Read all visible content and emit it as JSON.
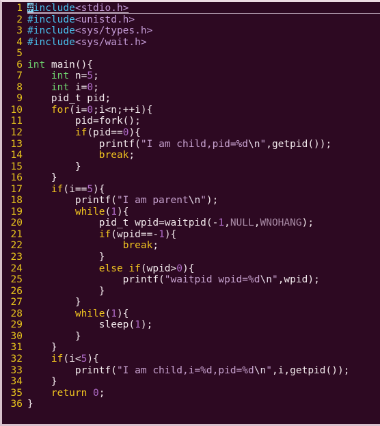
{
  "editor": {
    "language": "c",
    "total_lines": 36,
    "cursor": {
      "line": 1,
      "column": 1,
      "char": "#"
    },
    "colors": {
      "background": "#2d0922",
      "foreground": "#f2e9ec",
      "line_number": "#e8c51c",
      "preprocessor": "#49c0ed",
      "header_name": "#c39bd6",
      "type": "#6fd36f",
      "keyword": "#f0c420",
      "number": "#b06cc8",
      "string": "#c7a2cf",
      "escape": "#e6dbe9",
      "constant": "#a98ba6",
      "cursor_block": "#7fd4f2",
      "border": "#d8c2cd"
    }
  },
  "lines": [
    {
      "n": "1",
      "tokens": [
        {
          "t": "#",
          "c": "cursor-block"
        },
        {
          "t": "include",
          "c": "tok-pre"
        },
        {
          "t": "<stdio.h>",
          "c": "tok-header"
        }
      ]
    },
    {
      "n": "2",
      "tokens": [
        {
          "t": "#include",
          "c": "tok-pre"
        },
        {
          "t": "<unistd.h>",
          "c": "tok-header"
        }
      ]
    },
    {
      "n": "3",
      "tokens": [
        {
          "t": "#include",
          "c": "tok-pre"
        },
        {
          "t": "<sys/types.h>",
          "c": "tok-header"
        }
      ]
    },
    {
      "n": "4",
      "tokens": [
        {
          "t": "#include",
          "c": "tok-pre"
        },
        {
          "t": "<sys/wait.h>",
          "c": "tok-header"
        }
      ]
    },
    {
      "n": "5",
      "tokens": []
    },
    {
      "n": "6",
      "tokens": [
        {
          "t": "int",
          "c": "tok-type"
        },
        {
          "t": " main(){",
          "c": "tok-plain"
        }
      ]
    },
    {
      "n": "7",
      "tokens": [
        {
          "t": "    ",
          "c": "tok-plain"
        },
        {
          "t": "int",
          "c": "tok-type"
        },
        {
          "t": " n=",
          "c": "tok-plain"
        },
        {
          "t": "5",
          "c": "tok-num"
        },
        {
          "t": ";",
          "c": "tok-plain"
        }
      ]
    },
    {
      "n": "8",
      "tokens": [
        {
          "t": "    ",
          "c": "tok-plain"
        },
        {
          "t": "int",
          "c": "tok-type"
        },
        {
          "t": " i=",
          "c": "tok-plain"
        },
        {
          "t": "0",
          "c": "tok-num"
        },
        {
          "t": ";",
          "c": "tok-plain"
        }
      ]
    },
    {
      "n": "9",
      "tokens": [
        {
          "t": "    pid_t pid;",
          "c": "tok-plain"
        }
      ]
    },
    {
      "n": "10",
      "tokens": [
        {
          "t": "    ",
          "c": "tok-plain"
        },
        {
          "t": "for",
          "c": "tok-kw"
        },
        {
          "t": "(i=",
          "c": "tok-plain"
        },
        {
          "t": "0",
          "c": "tok-num"
        },
        {
          "t": ";i<n;++i){",
          "c": "tok-plain"
        }
      ]
    },
    {
      "n": "11",
      "tokens": [
        {
          "t": "        pid=fork();",
          "c": "tok-plain"
        }
      ]
    },
    {
      "n": "12",
      "tokens": [
        {
          "t": "        ",
          "c": "tok-plain"
        },
        {
          "t": "if",
          "c": "tok-kw"
        },
        {
          "t": "(pid==",
          "c": "tok-plain"
        },
        {
          "t": "0",
          "c": "tok-num"
        },
        {
          "t": "){",
          "c": "tok-plain"
        }
      ]
    },
    {
      "n": "13",
      "tokens": [
        {
          "t": "            printf(",
          "c": "tok-plain"
        },
        {
          "t": "\"I am child,pid=%d",
          "c": "tok-str"
        },
        {
          "t": "\\n",
          "c": "tok-esc"
        },
        {
          "t": "\"",
          "c": "tok-str"
        },
        {
          "t": ",getpid());",
          "c": "tok-plain"
        }
      ]
    },
    {
      "n": "14",
      "tokens": [
        {
          "t": "            ",
          "c": "tok-plain"
        },
        {
          "t": "break",
          "c": "tok-kw"
        },
        {
          "t": ";",
          "c": "tok-plain"
        }
      ]
    },
    {
      "n": "15",
      "tokens": [
        {
          "t": "        }",
          "c": "tok-plain"
        }
      ]
    },
    {
      "n": "16",
      "tokens": [
        {
          "t": "    }",
          "c": "tok-plain"
        }
      ]
    },
    {
      "n": "17",
      "tokens": [
        {
          "t": "    ",
          "c": "tok-plain"
        },
        {
          "t": "if",
          "c": "tok-kw"
        },
        {
          "t": "(i==",
          "c": "tok-plain"
        },
        {
          "t": "5",
          "c": "tok-num"
        },
        {
          "t": "){",
          "c": "tok-plain"
        }
      ]
    },
    {
      "n": "18",
      "tokens": [
        {
          "t": "        printf(",
          "c": "tok-plain"
        },
        {
          "t": "\"I am parent",
          "c": "tok-str"
        },
        {
          "t": "\\n",
          "c": "tok-esc"
        },
        {
          "t": "\"",
          "c": "tok-str"
        },
        {
          "t": ");",
          "c": "tok-plain"
        }
      ]
    },
    {
      "n": "19",
      "tokens": [
        {
          "t": "        ",
          "c": "tok-plain"
        },
        {
          "t": "while",
          "c": "tok-kw"
        },
        {
          "t": "(",
          "c": "tok-plain"
        },
        {
          "t": "1",
          "c": "tok-num"
        },
        {
          "t": "){",
          "c": "tok-plain"
        }
      ]
    },
    {
      "n": "20",
      "tokens": [
        {
          "t": "            pid_t wpid=waitpid(-",
          "c": "tok-plain"
        },
        {
          "t": "1",
          "c": "tok-num"
        },
        {
          "t": ",",
          "c": "tok-plain"
        },
        {
          "t": "NULL",
          "c": "tok-const"
        },
        {
          "t": ",",
          "c": "tok-plain"
        },
        {
          "t": "WNOHANG",
          "c": "tok-const"
        },
        {
          "t": ");",
          "c": "tok-plain"
        }
      ]
    },
    {
      "n": "21",
      "tokens": [
        {
          "t": "            ",
          "c": "tok-plain"
        },
        {
          "t": "if",
          "c": "tok-kw"
        },
        {
          "t": "(wpid==-",
          "c": "tok-plain"
        },
        {
          "t": "1",
          "c": "tok-num"
        },
        {
          "t": "){",
          "c": "tok-plain"
        }
      ]
    },
    {
      "n": "22",
      "tokens": [
        {
          "t": "                ",
          "c": "tok-plain"
        },
        {
          "t": "break",
          "c": "tok-kw"
        },
        {
          "t": ";",
          "c": "tok-plain"
        }
      ]
    },
    {
      "n": "23",
      "tokens": [
        {
          "t": "            }",
          "c": "tok-plain"
        }
      ]
    },
    {
      "n": "24",
      "tokens": [
        {
          "t": "            ",
          "c": "tok-plain"
        },
        {
          "t": "else",
          "c": "tok-kw"
        },
        {
          "t": " ",
          "c": "tok-plain"
        },
        {
          "t": "if",
          "c": "tok-kw"
        },
        {
          "t": "(wpid>",
          "c": "tok-plain"
        },
        {
          "t": "0",
          "c": "tok-num"
        },
        {
          "t": "){",
          "c": "tok-plain"
        }
      ]
    },
    {
      "n": "25",
      "tokens": [
        {
          "t": "                printf(",
          "c": "tok-plain"
        },
        {
          "t": "\"waitpid wpid=%d",
          "c": "tok-str"
        },
        {
          "t": "\\n",
          "c": "tok-esc"
        },
        {
          "t": "\"",
          "c": "tok-str"
        },
        {
          "t": ",wpid);",
          "c": "tok-plain"
        }
      ]
    },
    {
      "n": "26",
      "tokens": [
        {
          "t": "            }",
          "c": "tok-plain"
        }
      ]
    },
    {
      "n": "27",
      "tokens": [
        {
          "t": "        }",
          "c": "tok-plain"
        }
      ]
    },
    {
      "n": "28",
      "tokens": [
        {
          "t": "        ",
          "c": "tok-plain"
        },
        {
          "t": "while",
          "c": "tok-kw"
        },
        {
          "t": "(",
          "c": "tok-plain"
        },
        {
          "t": "1",
          "c": "tok-num"
        },
        {
          "t": "){",
          "c": "tok-plain"
        }
      ]
    },
    {
      "n": "29",
      "tokens": [
        {
          "t": "            sleep(",
          "c": "tok-plain"
        },
        {
          "t": "1",
          "c": "tok-num"
        },
        {
          "t": ");",
          "c": "tok-plain"
        }
      ]
    },
    {
      "n": "30",
      "tokens": [
        {
          "t": "        }",
          "c": "tok-plain"
        }
      ]
    },
    {
      "n": "31",
      "tokens": [
        {
          "t": "    }",
          "c": "tok-plain"
        }
      ]
    },
    {
      "n": "32",
      "tokens": [
        {
          "t": "    ",
          "c": "tok-plain"
        },
        {
          "t": "if",
          "c": "tok-kw"
        },
        {
          "t": "(i<",
          "c": "tok-plain"
        },
        {
          "t": "5",
          "c": "tok-num"
        },
        {
          "t": "){",
          "c": "tok-plain"
        }
      ]
    },
    {
      "n": "33",
      "tokens": [
        {
          "t": "        printf(",
          "c": "tok-plain"
        },
        {
          "t": "\"I am child,i=%d,pid=%d",
          "c": "tok-str"
        },
        {
          "t": "\\n",
          "c": "tok-esc"
        },
        {
          "t": "\"",
          "c": "tok-str"
        },
        {
          "t": ",i,getpid());",
          "c": "tok-plain"
        }
      ]
    },
    {
      "n": "34",
      "tokens": [
        {
          "t": "    }",
          "c": "tok-plain"
        }
      ]
    },
    {
      "n": "35",
      "tokens": [
        {
          "t": "    ",
          "c": "tok-plain"
        },
        {
          "t": "return",
          "c": "tok-kw"
        },
        {
          "t": " ",
          "c": "tok-plain"
        },
        {
          "t": "0",
          "c": "tok-num"
        },
        {
          "t": ";",
          "c": "tok-plain"
        }
      ]
    },
    {
      "n": "36",
      "tokens": [
        {
          "t": "}",
          "c": "tok-plain"
        }
      ]
    }
  ]
}
